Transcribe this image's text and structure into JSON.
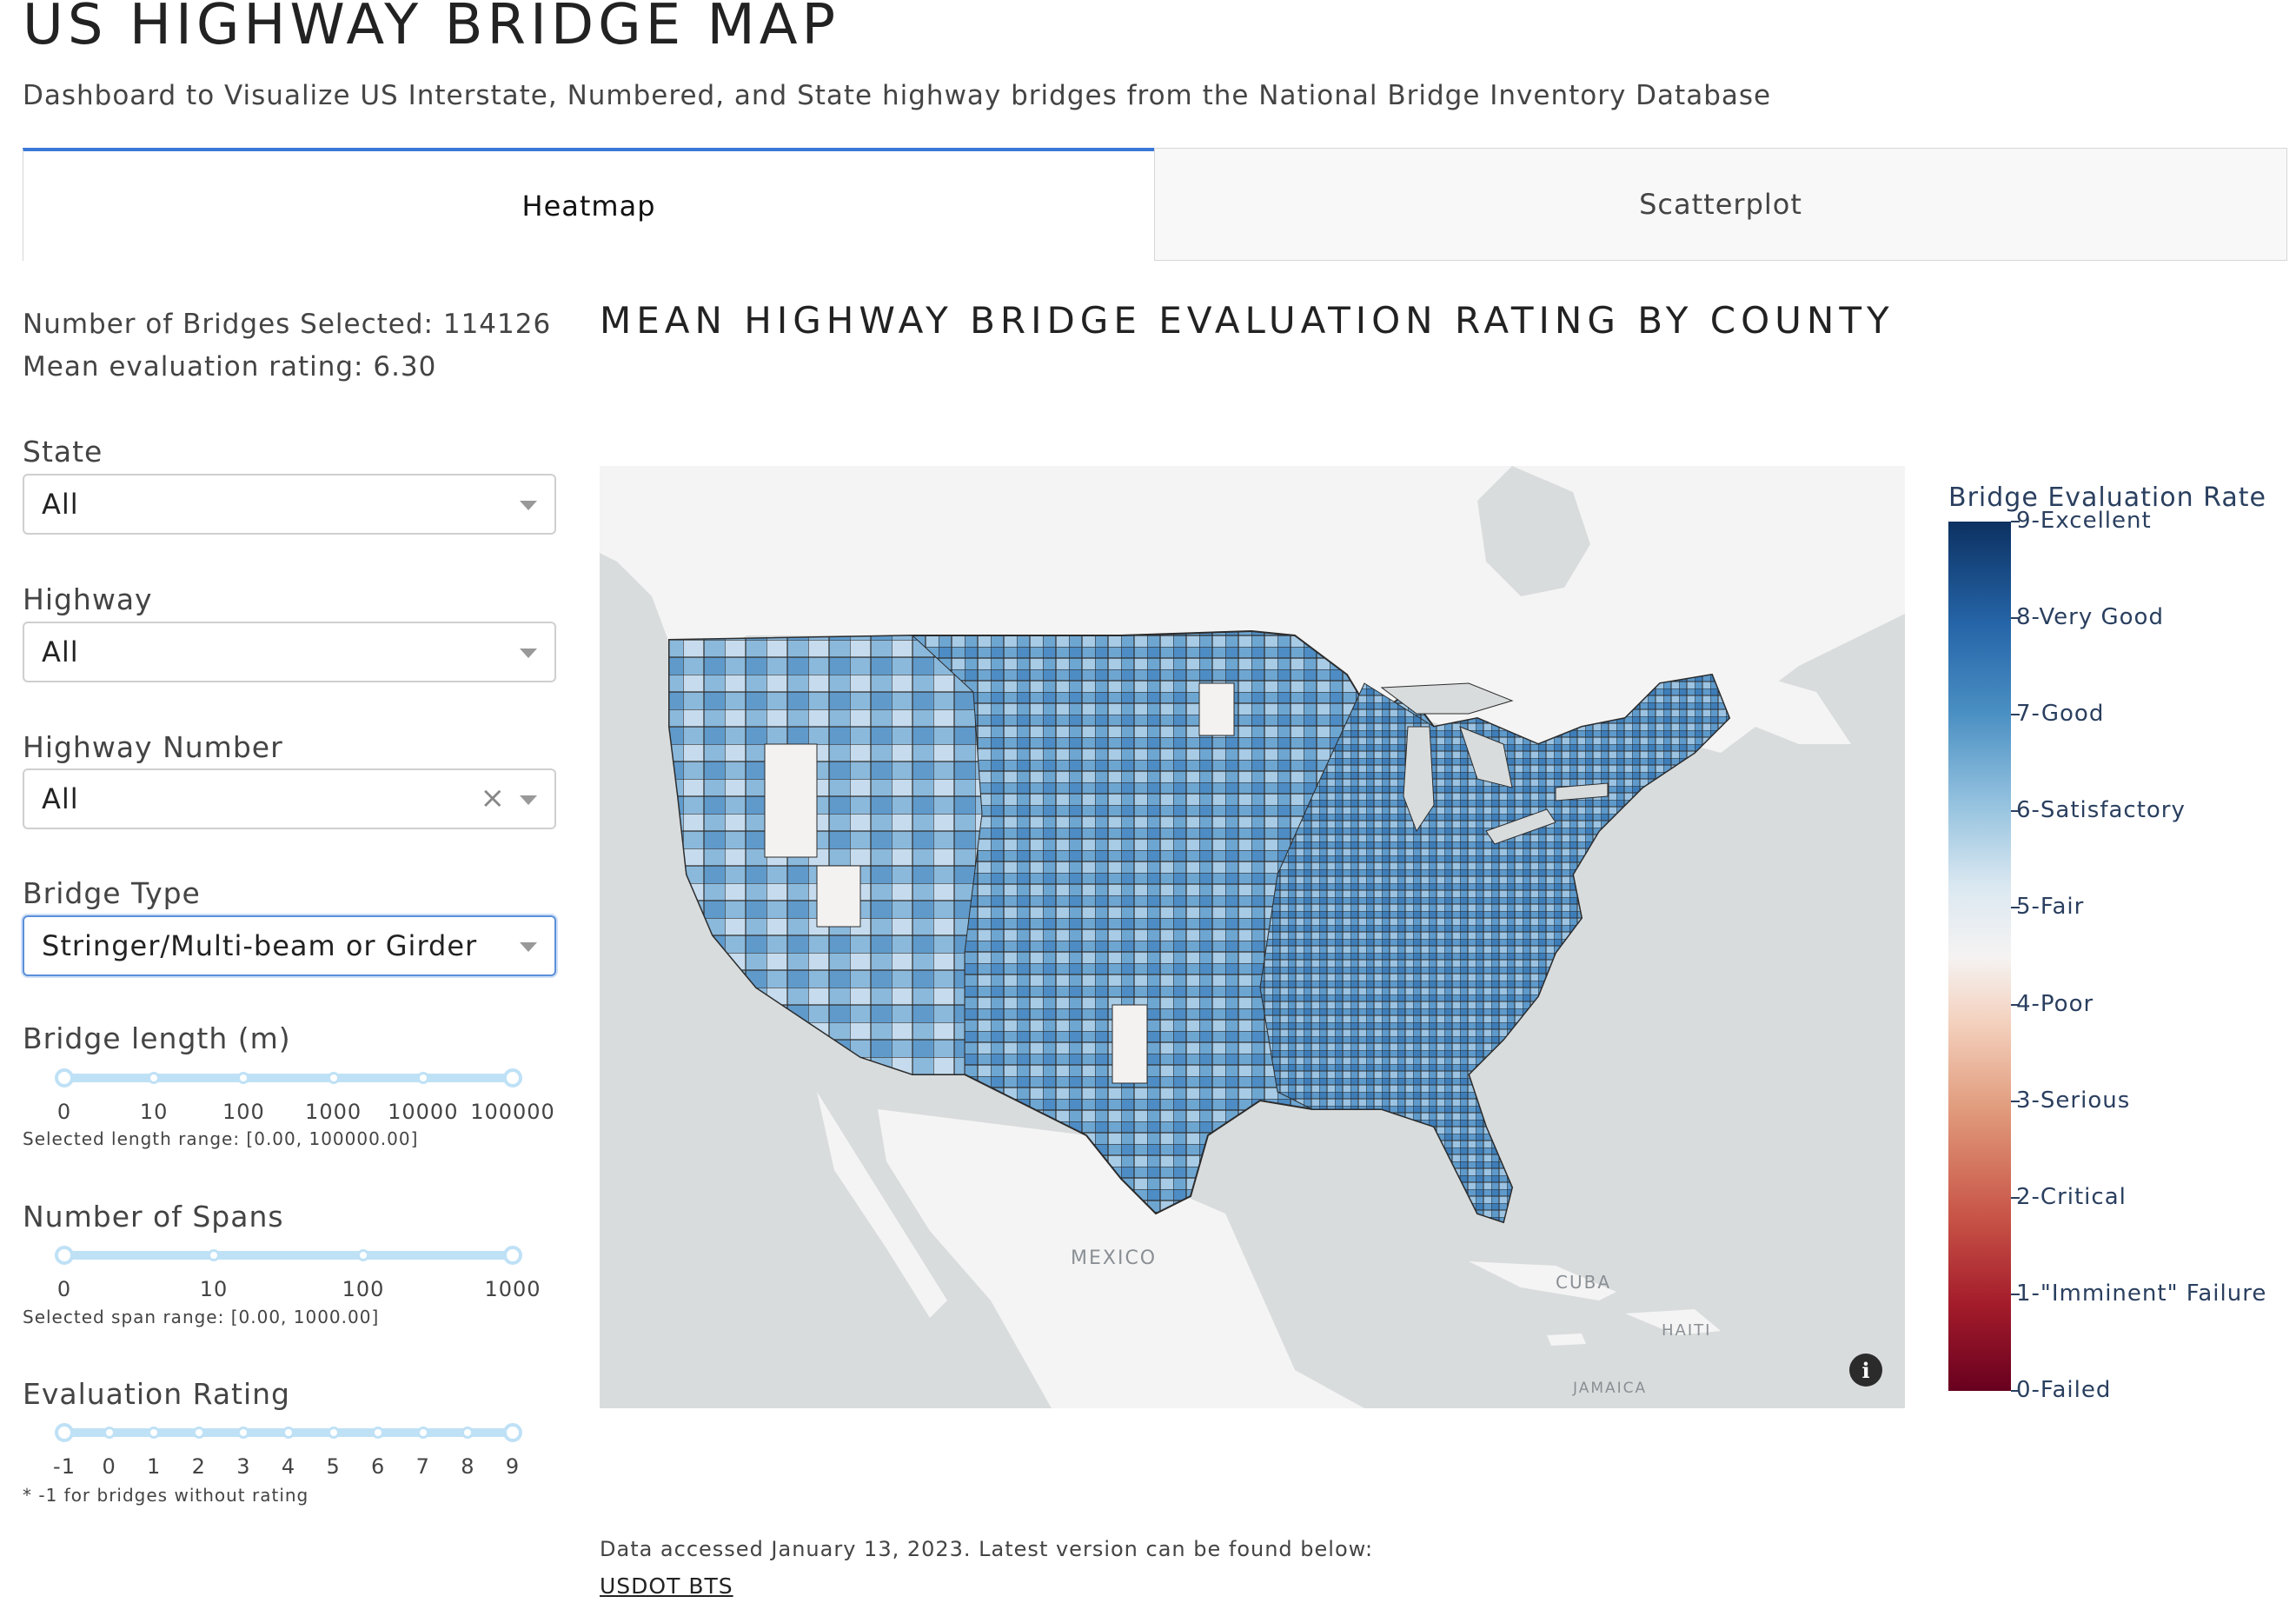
{
  "header": {
    "title": "US HIGHWAY BRIDGE MAP",
    "subtitle": "Dashboard to Visualize US Interstate, Numbered, and State highway bridges from the National Bridge Inventory Database"
  },
  "tabs": [
    {
      "label": "Heatmap",
      "active": true
    },
    {
      "label": "Scatterplot",
      "active": false
    }
  ],
  "sidebar": {
    "bridges_selected": "Number of Bridges Selected: 114126",
    "mean_rating": "Mean evaluation rating: 6.30",
    "state": {
      "label": "State",
      "value": "All"
    },
    "highway": {
      "label": "Highway",
      "value": "All"
    },
    "highway_number": {
      "label": "Highway Number",
      "value": "All",
      "clear_glyph": "×"
    },
    "bridge_type": {
      "label": "Bridge Type",
      "value": "Stringer/Multi-beam or Girder"
    },
    "length_slider": {
      "label": "Bridge length (m)",
      "ticks": [
        "0",
        "10",
        "100",
        "1000",
        "10000",
        "100000"
      ],
      "range": [
        0,
        100000
      ],
      "note": "Selected length range: [0.00, 100000.00]"
    },
    "spans_slider": {
      "label": "Number of Spans",
      "ticks": [
        "0",
        "10",
        "100",
        "1000"
      ],
      "range": [
        0,
        1000
      ],
      "note": "Selected span range: [0.00, 1000.00]"
    },
    "rating_slider": {
      "label": "Evaluation Rating",
      "ticks": [
        "-1",
        "0",
        "1",
        "2",
        "3",
        "4",
        "5",
        "6",
        "7",
        "8",
        "9"
      ],
      "range": [
        -1,
        9
      ],
      "note": "* -1 for bridges without rating"
    }
  },
  "map": {
    "title": "MEAN HIGHWAY BRIDGE EVALUATION RATING BY COUNTY",
    "labels": {
      "mexico": "MEXICO",
      "cuba": "CUBA",
      "haiti": "HAITI",
      "jamaica": "JAMAICA"
    },
    "info_glyph": "i",
    "colorbar": {
      "title": "Bridge Evaluation Rate",
      "ticks": [
        "9-Excellent",
        "8-Very Good",
        "7-Good",
        "6-Satisfactory",
        "5-Fair",
        "4-Poor",
        "3-Serious",
        "2-Critical",
        "1-\"Imminent\" Failure",
        "0-Failed"
      ],
      "range": [
        0,
        9
      ]
    },
    "colors": {
      "ocean": "#d9dcdd",
      "land": "#f4f4f4",
      "county_border": "#2c2c2c",
      "accent_blue": "#3a78d8"
    }
  },
  "footer": {
    "note": "Data accessed January 13, 2023. Latest version can be found below:",
    "link": "USDOT BTS"
  }
}
